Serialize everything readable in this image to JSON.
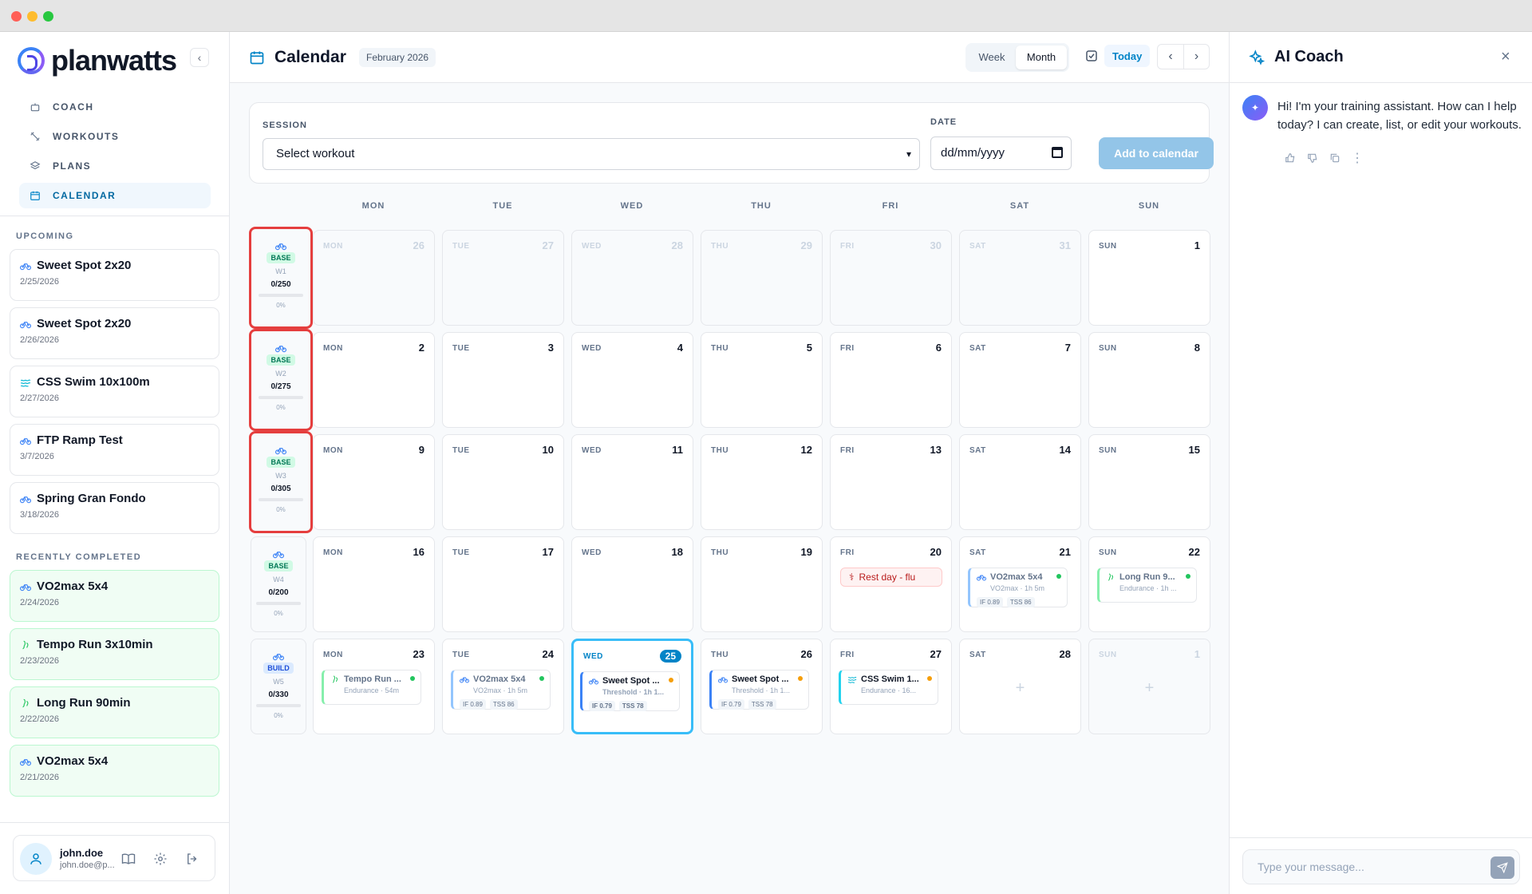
{
  "app": {
    "logo_text": "planwatts"
  },
  "nav": [
    {
      "label": "COACH",
      "icon": "robot-icon"
    },
    {
      "label": "WORKOUTS",
      "icon": "dumbbell-icon"
    },
    {
      "label": "PLANS",
      "icon": "layers-icon"
    },
    {
      "label": "CALENDAR",
      "icon": "calendar-icon",
      "active": true
    }
  ],
  "upcoming": {
    "label": "UPCOMING",
    "items": [
      {
        "title": "Sweet Spot 2x20",
        "date": "2/25/2026",
        "sport": "bike"
      },
      {
        "title": "Sweet Spot 2x20",
        "date": "2/26/2026",
        "sport": "bike"
      },
      {
        "title": "CSS Swim 10x100m",
        "date": "2/27/2026",
        "sport": "swim"
      },
      {
        "title": "FTP Ramp Test",
        "date": "3/7/2026",
        "sport": "bike"
      },
      {
        "title": "Spring Gran Fondo",
        "date": "3/18/2026",
        "sport": "bike"
      }
    ]
  },
  "completed": {
    "label": "RECENTLY COMPLETED",
    "items": [
      {
        "title": "VO2max 5x4",
        "date": "2/24/2026",
        "sport": "bike"
      },
      {
        "title": "Tempo Run 3x10min",
        "date": "2/23/2026",
        "sport": "run"
      },
      {
        "title": "Long Run 90min",
        "date": "2/22/2026",
        "sport": "run"
      },
      {
        "title": "VO2max 5x4",
        "date": "2/21/2026",
        "sport": "bike"
      }
    ]
  },
  "user": {
    "name": "john.doe",
    "email": "john.doe@p..."
  },
  "header": {
    "title": "Calendar",
    "month_badge": "February 2026",
    "view_week": "Week",
    "view_month": "Month",
    "today": "Today",
    "active_view": "Month"
  },
  "add_form": {
    "session_label": "SESSION",
    "session_value": "Select workout",
    "date_label": "DATE",
    "date_value": "dd/mm/yyyy",
    "submit": "Add to calendar"
  },
  "weekdays": [
    "MON",
    "TUE",
    "WED",
    "THU",
    "FRI",
    "SAT",
    "SUN"
  ],
  "weeks": [
    {
      "phase": "BASE",
      "week": "W1",
      "tss": "0/250",
      "pct": "0%",
      "progress": 0,
      "highlighted": true
    },
    {
      "phase": "BASE",
      "week": "W2",
      "tss": "0/275",
      "pct": "0%",
      "progress": 0,
      "highlighted": true
    },
    {
      "phase": "BASE",
      "week": "W3",
      "tss": "0/305",
      "pct": "0%",
      "progress": 0,
      "highlighted": true
    },
    {
      "phase": "BASE",
      "week": "W4",
      "tss": "0/200",
      "pct": "0%",
      "progress": 0,
      "highlighted": false
    },
    {
      "phase": "BUILD",
      "week": "W5",
      "tss": "0/330",
      "pct": "0%",
      "progress": 0,
      "highlighted": false
    }
  ],
  "days": [
    [
      {
        "d": "26",
        "out": true
      },
      {
        "d": "27",
        "out": true
      },
      {
        "d": "28",
        "out": true
      },
      {
        "d": "29",
        "out": true
      },
      {
        "d": "30",
        "out": true
      },
      {
        "d": "31",
        "out": true
      },
      {
        "d": "1"
      }
    ],
    [
      {
        "d": "2"
      },
      {
        "d": "3"
      },
      {
        "d": "4"
      },
      {
        "d": "5"
      },
      {
        "d": "6"
      },
      {
        "d": "7"
      },
      {
        "d": "8"
      }
    ],
    [
      {
        "d": "9"
      },
      {
        "d": "10"
      },
      {
        "d": "11"
      },
      {
        "d": "12"
      },
      {
        "d": "13"
      },
      {
        "d": "14"
      },
      {
        "d": "15"
      }
    ],
    [
      {
        "d": "16"
      },
      {
        "d": "17"
      },
      {
        "d": "18"
      },
      {
        "d": "19"
      },
      {
        "d": "20",
        "rest": "Rest day - flu"
      },
      {
        "d": "21",
        "event": {
          "title": "VO2max 5x4",
          "sub": "VO2max · 1h 5m",
          "chips": [
            "IF 0.89",
            "TSS 86"
          ],
          "sport": "bike",
          "status": "#22c55e",
          "faded": true
        }
      },
      {
        "d": "22",
        "event": {
          "title": "Long Run 9...",
          "sub": "Endurance · 1h ...",
          "chips": [],
          "sport": "run",
          "status": "#22c55e",
          "faded": true
        }
      }
    ],
    [
      {
        "d": "23",
        "event": {
          "title": "Tempo Run ...",
          "sub": "Endurance · 54m",
          "chips": [],
          "sport": "run",
          "status": "#22c55e",
          "faded": true
        }
      },
      {
        "d": "24",
        "event": {
          "title": "VO2max 5x4",
          "sub": "VO2max · 1h 5m",
          "chips": [
            "IF 0.89",
            "TSS 86"
          ],
          "sport": "bike",
          "status": "#22c55e",
          "faded": true
        }
      },
      {
        "d": "25",
        "today": true,
        "event": {
          "title": "Sweet Spot ...",
          "sub": "Threshold · 1h 1...",
          "chips": [
            "IF 0.79",
            "TSS 78"
          ],
          "sport": "bike",
          "status": "#f59e0b",
          "thr": true
        }
      },
      {
        "d": "26",
        "event": {
          "title": "Sweet Spot ...",
          "sub": "Threshold · 1h 1...",
          "chips": [
            "IF 0.79",
            "TSS 78"
          ],
          "sport": "bike",
          "status": "#f59e0b",
          "thr": true
        }
      },
      {
        "d": "27",
        "event": {
          "title": "CSS Swim 1...",
          "sub": "Endurance · 16...",
          "chips": [],
          "sport": "swim",
          "status": "#f59e0b"
        }
      },
      {
        "d": "28",
        "plus": true
      },
      {
        "d": "1",
        "out": true,
        "plus": true
      }
    ]
  ],
  "coach": {
    "title": "AI Coach",
    "message": "Hi! I'm your training assistant. How can I help today? I can create, list, or edit your workouts.",
    "placeholder": "Type your message..."
  }
}
